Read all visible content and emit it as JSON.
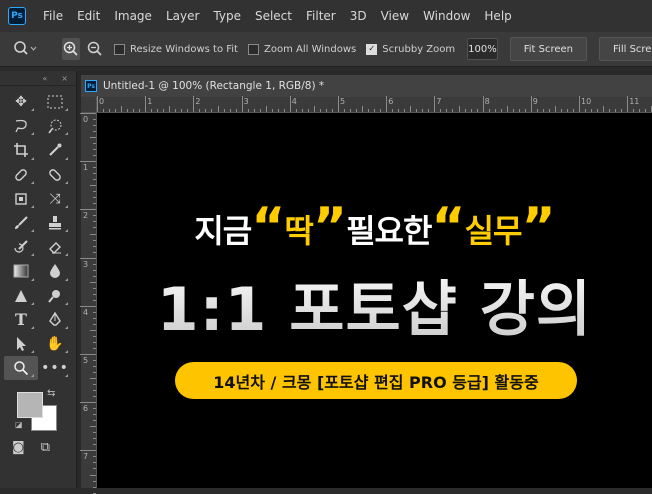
{
  "app": {
    "logo": "Ps"
  },
  "menu": [
    "File",
    "Edit",
    "Image",
    "Layer",
    "Type",
    "Select",
    "Filter",
    "3D",
    "View",
    "Window",
    "Help"
  ],
  "options": {
    "resize_windows": {
      "label": "Resize Windows to Fit",
      "checked": false
    },
    "zoom_all": {
      "label": "Zoom All Windows",
      "checked": false
    },
    "scrubby": {
      "label": "Scrubby Zoom",
      "checked": true
    },
    "zoom_value": "100%",
    "fit_screen": "Fit Screen",
    "fill_screen": "Fill Screen"
  },
  "tools_panel": {
    "collapse_glyph": "«",
    "close_glyph": "×"
  },
  "document": {
    "tab_title": "Untitled-1 @ 100% (Rectangle 1, RGB/8) *",
    "ruler_h": [
      "0",
      "1",
      "2",
      "3",
      "4",
      "5",
      "6",
      "7",
      "8",
      "9",
      "10",
      "11"
    ],
    "ruler_v": [
      "0",
      "1",
      "2",
      "3",
      "4",
      "5",
      "6",
      "7"
    ]
  },
  "artwork": {
    "line1_a": "지금",
    "q_open": "“",
    "word1": "딱",
    "q_close": "”",
    "line1_b": "필요한",
    "word2": "실무",
    "line2": "1:1 포토샵 강의",
    "badge": "14년차 / 크몽 [포토샵 편집 PRO 등급] 활동중"
  },
  "colors": {
    "accent": "#ffcc00",
    "foreground_swatch": "#b5b5b5",
    "background_swatch": "#ffffff"
  }
}
